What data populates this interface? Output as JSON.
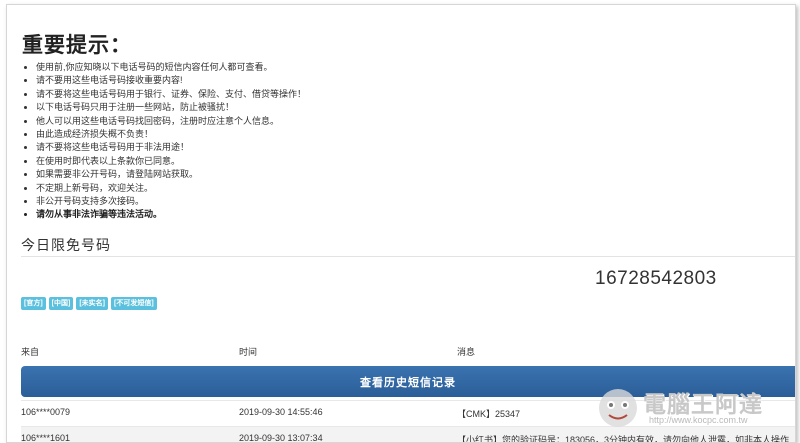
{
  "notice": {
    "title": "重要提示：",
    "items": [
      "使用前,你应知晓以下电话号码的短信内容任何人都可查看。",
      "请不要用这些电话号码接收重要内容!",
      "请不要将这些电话号码用于银行、证券、保险、支付、借贷等操作！",
      "以下电话号码只用于注册一些网站，防止被骚扰！",
      "他人可以用这些电话号码找回密码，注册时应注意个人信息。",
      "由此造成经济损失概不负责！",
      "请不要将这些电话号码用于非法用途！",
      "在使用时即代表以上条款你已同意。",
      "如果需要非公开号码，请登陆网站获取。",
      "不定期上新号码，欢迎关注。",
      "非公开号码支持多次接码。",
      "请勿从事非法诈骗等违法活动。"
    ]
  },
  "today": {
    "title": "今日限免号码",
    "phone_number": "16728542803",
    "tags": [
      "[官方]",
      "[中国]",
      "[未实名]",
      "[不可发短信]"
    ]
  },
  "table": {
    "headers": {
      "from": "来自",
      "time": "时间",
      "message": "消息"
    },
    "history_button": "查看历史短信记录",
    "rows": [
      {
        "from": "106****0079",
        "time": "2019-09-30 14:55:46",
        "message": "【CMK】25347"
      },
      {
        "from": "106****1601",
        "time": "2019-09-30 13:07:34",
        "message": "【小红书】您的验证码是：183056，3分钟内有效，请勿向他人泄露，如非本人操作"
      }
    ]
  },
  "watermark": {
    "text": "電腦王阿達",
    "url": "http://www.kocpc.com.tw"
  },
  "colors": {
    "tag": "#5bc0de",
    "button": "#2f67a3"
  }
}
